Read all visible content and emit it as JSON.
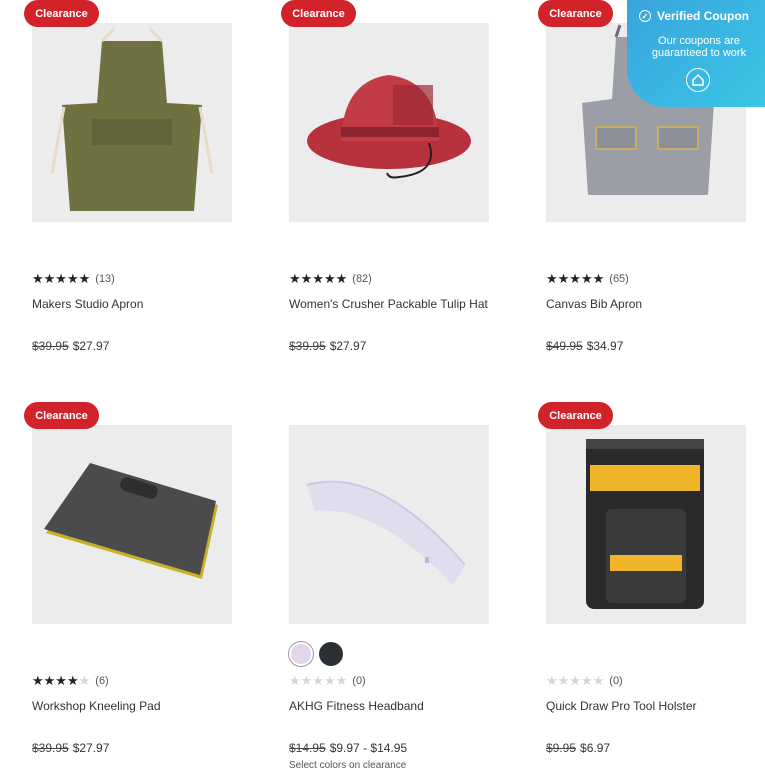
{
  "badge_label": "Clearance",
  "coupon": {
    "title": "Verified Coupon",
    "subtitle": "Our coupons are guaranteed to work",
    "icon": "home-shield-icon"
  },
  "products": [
    {
      "title": "Makers Studio Apron",
      "rating": 5,
      "count": "(13)",
      "was": "$39.95",
      "now": "$27.97",
      "clearance": true
    },
    {
      "title": "Women's Crusher Packable Tulip Hat",
      "rating": 5,
      "count": "(82)",
      "was": "$39.95",
      "now": "$27.97",
      "clearance": true
    },
    {
      "title": "Canvas Bib Apron",
      "rating": 5,
      "count": "(65)",
      "was": "$49.95",
      "now": "$34.97",
      "clearance": true
    },
    {
      "title": "Workshop Kneeling Pad",
      "rating": 4,
      "count": "(6)",
      "was": "$39.95",
      "now": "$27.97",
      "clearance": true
    },
    {
      "title": "AKHG Fitness Headband",
      "rating": 0,
      "count": "(0)",
      "was": "$14.95",
      "now": "$9.97 - $14.95",
      "note": "Select colors on clearance",
      "clearance": false,
      "swatches": [
        "#e4d6ea",
        "#2c2f33"
      ]
    },
    {
      "title": "Quick Draw Pro Tool Holster",
      "rating": 0,
      "count": "(0)",
      "was": "$9.95",
      "now": "$6.97",
      "clearance": true
    }
  ]
}
